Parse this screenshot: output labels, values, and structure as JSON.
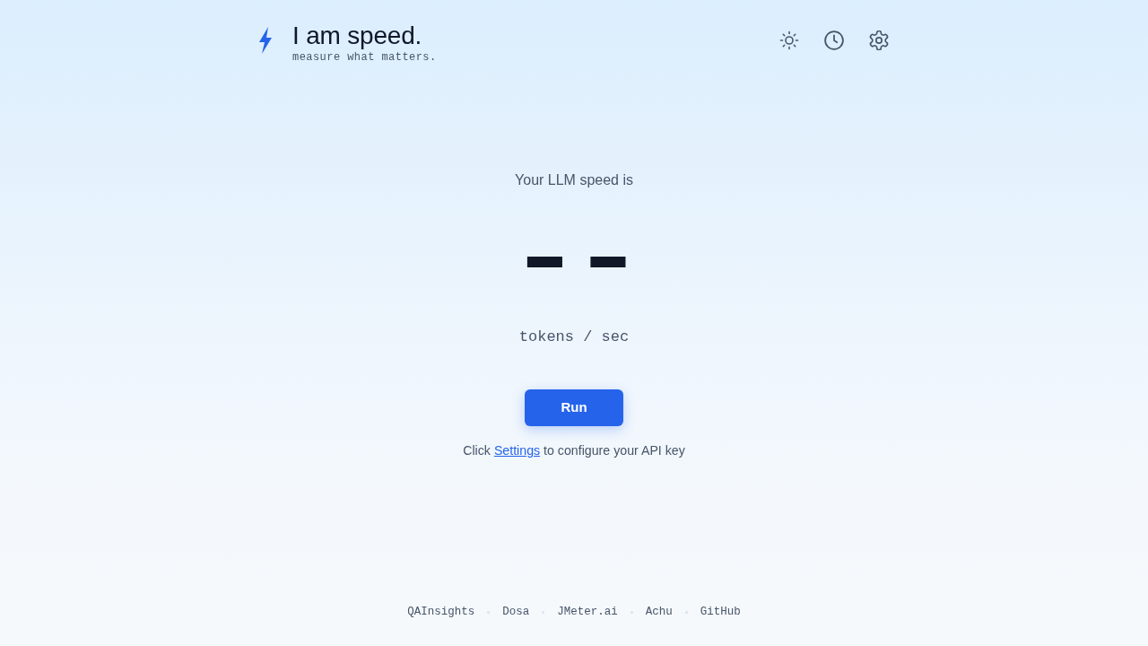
{
  "header": {
    "title": "I am speed.",
    "tagline": "measure what matters.",
    "actions": [
      {
        "kind": "theme"
      },
      {
        "kind": "history"
      },
      {
        "kind": "settings"
      }
    ]
  },
  "speed": {
    "label": "Your LLM speed is",
    "value": "--",
    "unit": "tokens / sec"
  },
  "run_button": {
    "label": "Run"
  },
  "hint": {
    "before": "Click",
    "link": "Settings",
    "after": "to configure your API key"
  },
  "footer": {
    "links": [
      "QAInsights",
      "Dosa",
      "JMeter.ai",
      "Achu",
      "GitHub"
    ]
  }
}
